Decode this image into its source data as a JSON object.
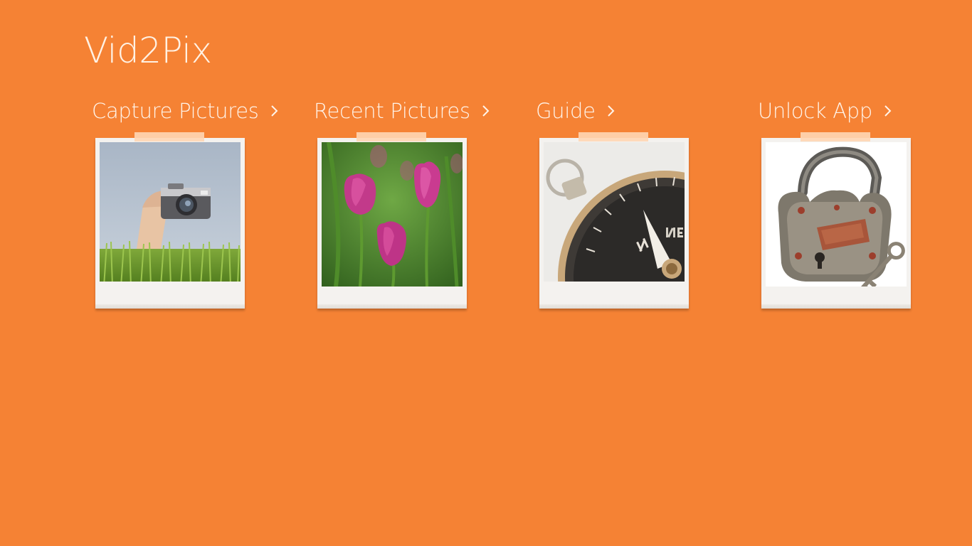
{
  "app": {
    "title": "Vid2Pix"
  },
  "colors": {
    "background": "#F58234",
    "text": "#FFF4EA",
    "tile": "#F4F2EF",
    "tape": "#FFD6B4"
  },
  "sections": [
    {
      "label": "Capture Pictures",
      "image": "camera-held-above-grass-photo",
      "icon": "chevron-right-icon"
    },
    {
      "label": "Recent Pictures",
      "image": "pink-tulips-photo",
      "icon": "chevron-right-icon"
    },
    {
      "label": "Guide",
      "image": "compass-photo",
      "icon": "chevron-right-icon"
    },
    {
      "label": "Unlock App",
      "image": "open-padlock-with-key-photo",
      "icon": "chevron-right-icon"
    }
  ]
}
